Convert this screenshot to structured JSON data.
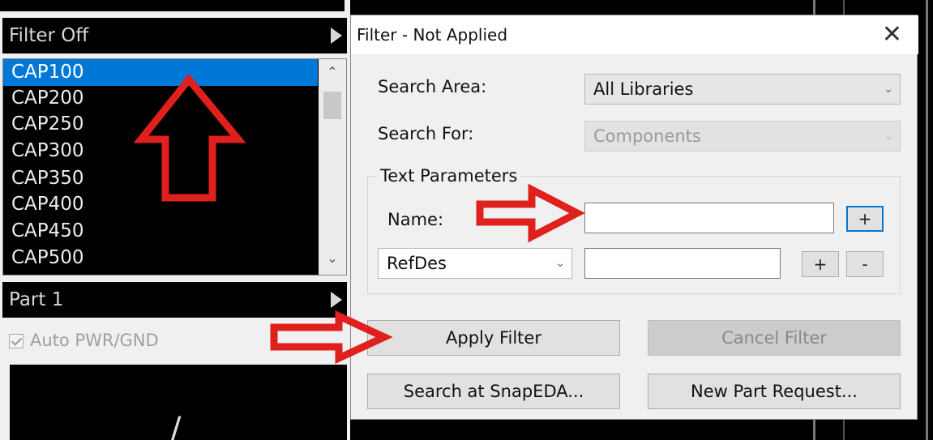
{
  "left_panel": {
    "filter_header": "Filter Off",
    "list_items": [
      "CAP100",
      "CAP200",
      "CAP250",
      "CAP300",
      "CAP350",
      "CAP400",
      "CAP450",
      "CAP500"
    ],
    "selected_index": 0,
    "part_header": "Part 1",
    "auto_pwr_gnd": {
      "label": "Auto PWR/GND",
      "checked": true,
      "enabled": false
    }
  },
  "dialog": {
    "title": "Filter - Not Applied",
    "close_icon": "close-icon",
    "search_area": {
      "label": "Search Area:",
      "value": "All Libraries"
    },
    "search_for": {
      "label": "Search For:",
      "value": "Components",
      "enabled": false
    },
    "text_parameters": {
      "group_title": "Text Parameters",
      "name_label": "Name:",
      "name_value": "",
      "add_label": "+",
      "param_select": "RefDes",
      "param_value": "",
      "remove_label": "-"
    },
    "buttons": {
      "apply": "Apply Filter",
      "cancel": "Cancel Filter",
      "search_snapeda": "Search at SnapEDA...",
      "new_part_request": "New Part Request..."
    }
  },
  "annotations": {
    "arrow_color": "#e0201c"
  },
  "colors": {
    "selection": "#0078d7",
    "dialog_bg": "#f0f0f0",
    "panel_bg": "#000000"
  }
}
